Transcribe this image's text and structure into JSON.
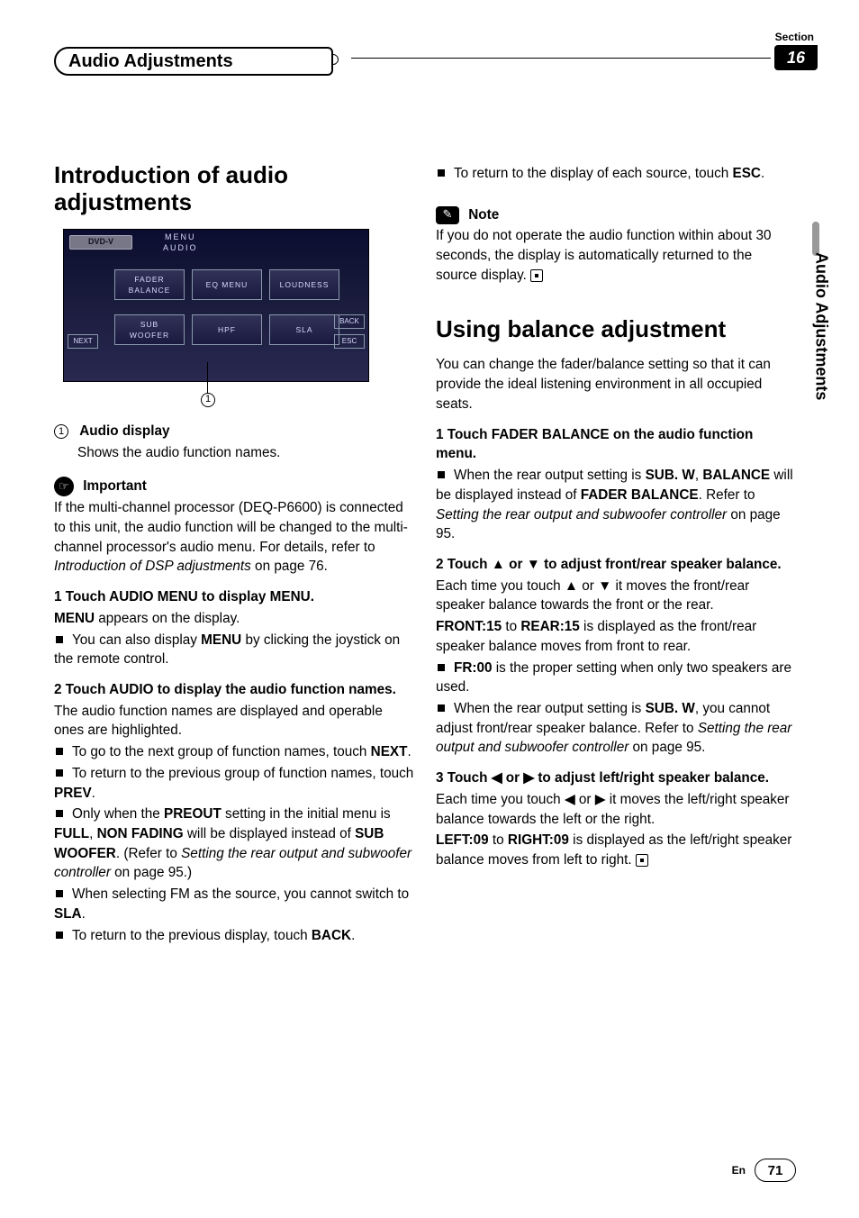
{
  "header": {
    "section_label": "Section",
    "section_number": "16",
    "breadcrumb_title": "Audio Adjustments",
    "side_tab": "Audio Adjustments"
  },
  "left": {
    "h1": "Introduction of audio adjustments",
    "screen": {
      "dvd": "DVD-V",
      "menu": "MENU",
      "audio": "AUDIO",
      "btn_fader1": "FADER",
      "btn_fader2": "BALANCE",
      "btn_eq": "EQ MENU",
      "btn_loud": "LOUDNESS",
      "btn_sub1": "SUB",
      "btn_sub2": "WOOFER",
      "btn_hpf": "HPF",
      "btn_sla": "SLA",
      "next": "NEXT",
      "back": "BACK",
      "esc": "ESC",
      "callout": "1"
    },
    "item1_label": "Audio display",
    "item1_desc": "Shows the audio function names.",
    "important_label": "Important",
    "important_text_1": "If the multi-channel processor (DEQ-P6600) is connected to this unit, the audio function will be changed to the multi-channel processor's audio menu. For details, refer to ",
    "important_text_italic": "Introduction of DSP adjustments",
    "important_text_2": " on page 76.",
    "step1": "1    Touch AUDIO MENU to display MENU.",
    "step1_desc1a": "MENU",
    "step1_desc1b": " appears on the display.",
    "step1_b1a": "You can also display ",
    "step1_b1b": "MENU",
    "step1_b1c": " by clicking the joystick on the remote control.",
    "step2": "2    Touch AUDIO to display the audio function names.",
    "step2_desc": "The audio function names are displayed and operable ones are highlighted.",
    "step2_b1a": "To go to the next group of function names, touch ",
    "step2_b1b": "NEXT",
    "step2_b1c": ".",
    "step2_b2a": "To return to the previous group of function names, touch ",
    "step2_b2b": "PREV",
    "step2_b2c": ".",
    "step2_b3a": "Only when the ",
    "step2_b3b": "PREOUT",
    "step2_b3c": " setting in the initial menu is ",
    "step2_b3d": "FULL",
    "step2_b3e": ", ",
    "step2_b3f": "NON FADING",
    "step2_b3g": " will be displayed instead of ",
    "step2_b3h": "SUB WOOFER",
    "step2_b3i": ". (Refer to ",
    "step2_b3j": "Setting the rear output and subwoofer controller",
    "step2_b3k": " on page 95.)",
    "step2_b4a": "When selecting FM as the source, you cannot switch to ",
    "step2_b4b": "SLA",
    "step2_b4c": ".",
    "step2_b5a": "To return to the previous display, touch ",
    "step2_b5b": "BACK",
    "step2_b5c": "."
  },
  "right": {
    "top_b1a": "To return to the display of each source, touch ",
    "top_b1b": "ESC",
    "top_b1c": ".",
    "note_label": "Note",
    "note_text": "If you do not operate the audio function within about 30 seconds, the display is automatically returned to the source display.",
    "h2": "Using balance adjustment",
    "h2_desc": "You can change the fader/balance setting so that it can provide the ideal listening environment in all occupied seats.",
    "r_step1": "1    Touch FADER BALANCE on the audio function menu.",
    "r_step1_b1a": "When the rear output setting is ",
    "r_step1_b1b": "SUB. W",
    "r_step1_b1c": ", ",
    "r_step1_b1d": "BALANCE",
    "r_step1_b1e": " will be displayed instead of ",
    "r_step1_b1f": "FADER BALANCE",
    "r_step1_b1g": ". Refer to ",
    "r_step1_b1h": "Setting the rear output and subwoofer controller",
    "r_step1_b1i": " on page 95.",
    "r_step2": "2    Touch ▲ or ▼ to adjust front/rear speaker balance.",
    "r_step2_desc1": "Each time you touch ▲ or ▼ it moves the front/rear speaker balance towards the front or the rear.",
    "r_step2_desc2a": "FRONT:15",
    "r_step2_desc2b": " to ",
    "r_step2_desc2c": "REAR:15",
    "r_step2_desc2d": " is displayed as the front/rear speaker balance moves from front to rear.",
    "r_step2_b1a": "FR:00",
    "r_step2_b1b": " is the proper setting when only two speakers are used.",
    "r_step2_b2a": "When the rear output setting is ",
    "r_step2_b2b": "SUB. W",
    "r_step2_b2c": ", you cannot adjust front/rear speaker balance. Refer to ",
    "r_step2_b2d": "Setting the rear output and subwoofer controller",
    "r_step2_b2e": " on page 95.",
    "r_step3": "3    Touch ◀ or ▶ to adjust left/right speaker balance.",
    "r_step3_desc1": "Each time you touch ◀ or ▶ it moves the left/right speaker balance towards the left or the right.",
    "r_step3_desc2a": "LEFT:09",
    "r_step3_desc2b": " to ",
    "r_step3_desc2c": "RIGHT:09",
    "r_step3_desc2d": " is displayed as the left/right speaker balance moves from left to right."
  },
  "footer": {
    "lang": "En",
    "page": "71"
  }
}
